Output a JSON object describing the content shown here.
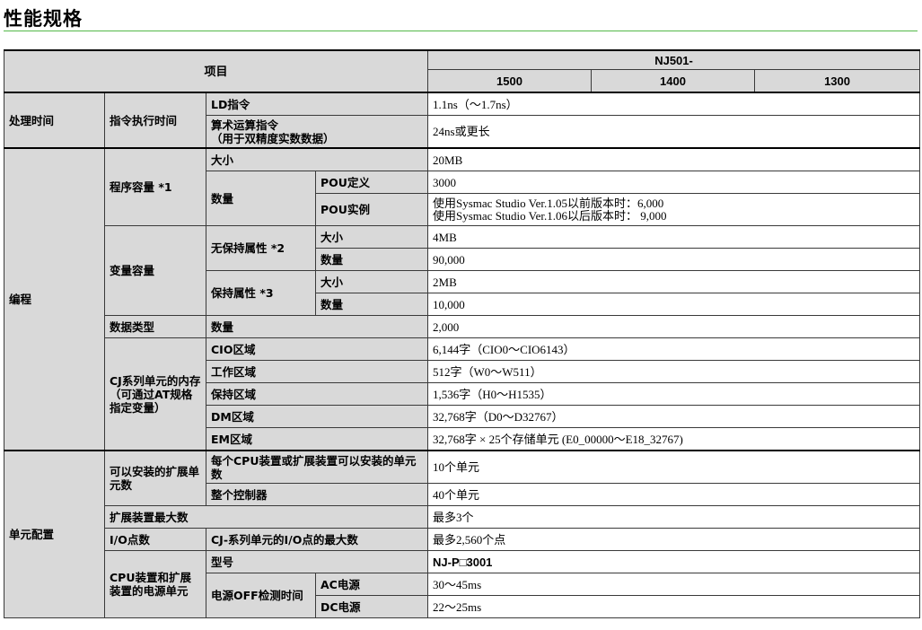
{
  "page_title": "性能规格",
  "accent_color": "#53b848",
  "header": {
    "item": "项目",
    "model": "NJ501-",
    "variants": [
      "1500",
      "1400",
      "1300"
    ]
  },
  "rows": {
    "processing_time": "处理时间",
    "instruction_exec_time": "指令执行时间",
    "ld_instruction": "LD指令",
    "ld_value": "1.1ns（～1.7ns）",
    "arith_instruction": "算术运算指令\n（用于双精度实数数据）",
    "arith_value": "24ns或更长",
    "programming": "编程",
    "program_capacity": "程序容量 *1",
    "size": "大小",
    "size_value": "20MB",
    "quantity": "数量",
    "pou_def": "POU定义",
    "pou_def_value": "3000",
    "pou_inst": "POU实例",
    "pou_inst_value": "使用Sysmac Studio Ver.1.05以前版本时：6,000\n使用Sysmac Studio Ver.1.06以后版本时： 9,000",
    "var_capacity": "变量容量",
    "non_retain": "无保持属性 *2",
    "nr_size": "大小",
    "nr_size_value": "4MB",
    "nr_qty": "数量",
    "nr_qty_value": "90,000",
    "retain": "保持属性 *3",
    "r_size": "大小",
    "r_size_value": "2MB",
    "r_qty": "数量",
    "r_qty_value": "10,000",
    "data_type": "数据类型",
    "dt_qty": "数量",
    "dt_qty_value": "2,000",
    "cj_memory": "CJ系列单元的内存（可通过AT规格指定变量）",
    "cio_area": "CIO区域",
    "cio_value": "6,144字（CIO0～CIO6143）",
    "work_area": "工作区域",
    "work_value": "512字（W0～W511）",
    "hold_area": "保持区域",
    "hold_value": "1,536字（H0～H1535）",
    "dm_area": "DM区域",
    "dm_value": "32,768字（D0～D32767）",
    "em_area": "EM区域",
    "em_value": "32,768字 × 25个存储单元 (E0_00000～E18_32767)",
    "unit_config": "单元配置",
    "mountable_units": "可以安装的扩展单元数",
    "per_cpu": "每个CPU装置或扩展装置可以安装的单元数",
    "per_cpu_value": "10个单元",
    "whole_controller": "整个控制器",
    "whole_value": "40个单元",
    "max_expansion": "扩展装置最大数",
    "max_expansion_value": "最多3个",
    "io_points": "I/O点数",
    "io_max": "CJ-系列单元的I/O点的最大数",
    "io_max_value": "最多2,560个点",
    "power_unit": "CPU装置和扩展装置的电源单元",
    "model": "型号",
    "model_value": "NJ-P□3001",
    "power_off": "电源OFF检测时间",
    "ac_power": "AC电源",
    "ac_value": "30～45ms",
    "dc_power": "DC电源",
    "dc_value": "22～25ms"
  }
}
